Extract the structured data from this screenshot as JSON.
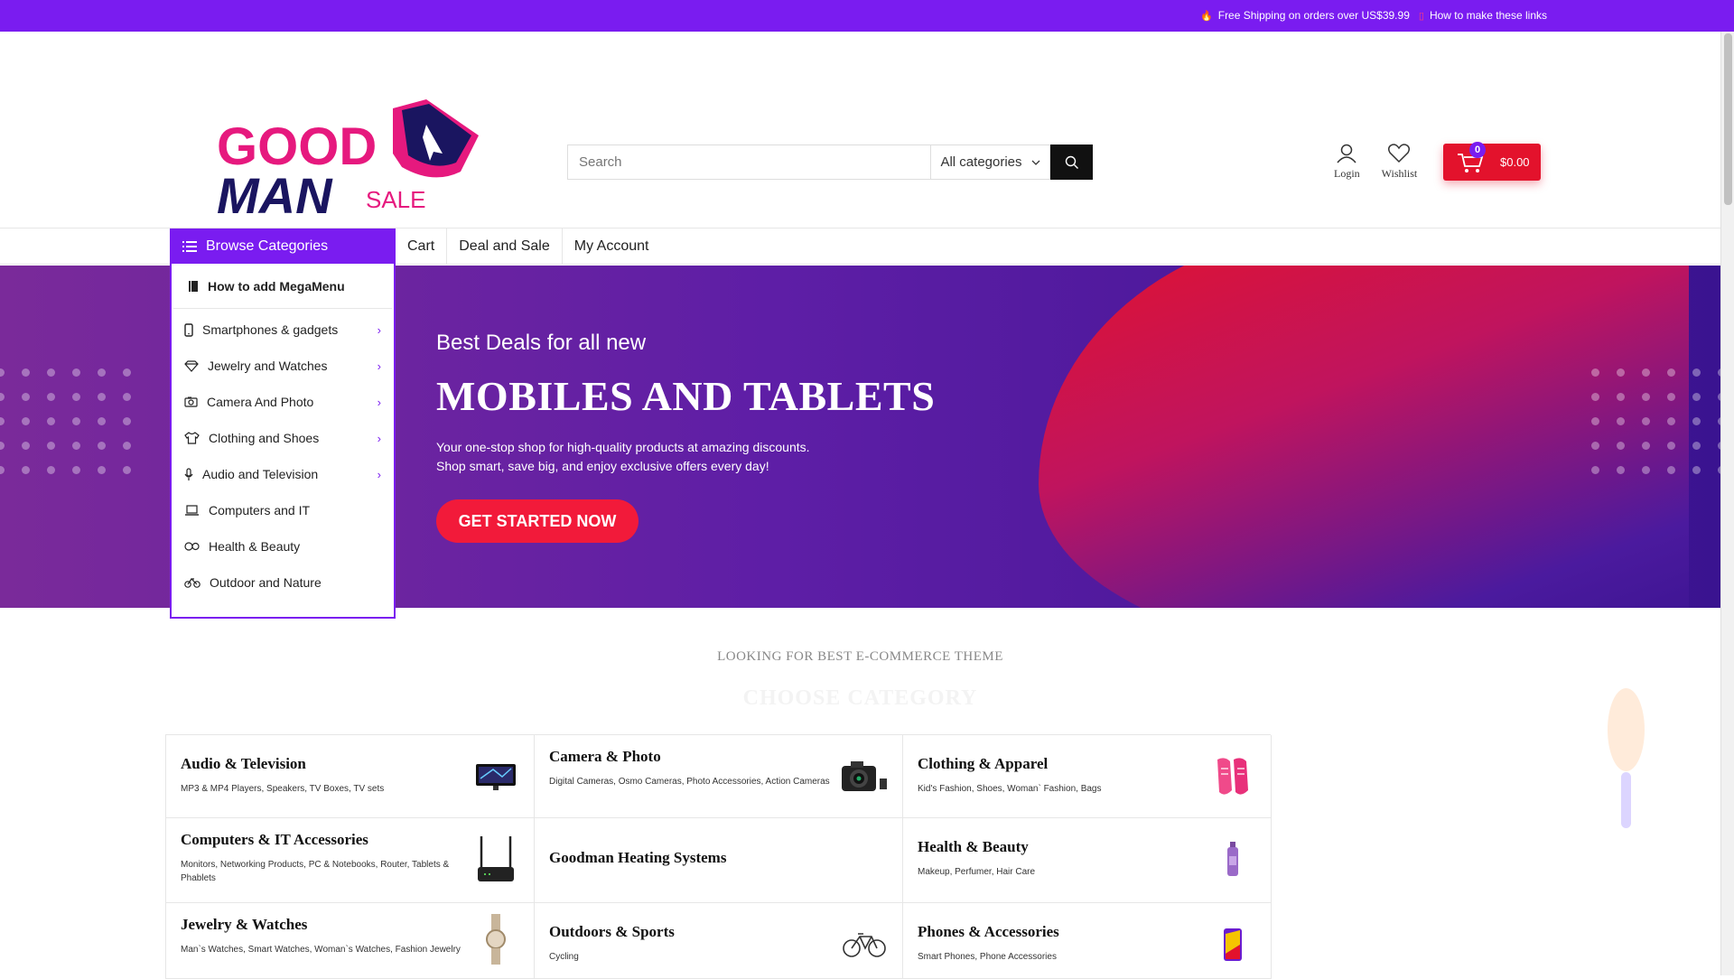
{
  "topbar": {
    "shipping_text": "Free Shipping on orders over US$39.99",
    "links_text": "How to make these links"
  },
  "logo": {
    "line1": "GOOD",
    "line2": "MAN",
    "tag": "SALE"
  },
  "search": {
    "placeholder": "Search",
    "category": "All categories"
  },
  "user_links": {
    "login": "Login",
    "wishlist": "Wishlist"
  },
  "cart": {
    "count": "0",
    "total": "$0.00"
  },
  "nav": {
    "browse_label": "Browse Categories",
    "links": [
      "Cart",
      "Deal and Sale",
      "My Account"
    ]
  },
  "megamenu": {
    "head": "How to add MegaMenu",
    "items": [
      {
        "label": "Smartphones & gadgets",
        "icon": "smartphone-icon"
      },
      {
        "label": "Jewelry and Watches",
        "icon": "diamond-icon"
      },
      {
        "label": "Camera And Photo",
        "icon": "camera-icon"
      },
      {
        "label": "Clothing and Shoes",
        "icon": "tshirt-icon"
      },
      {
        "label": "Audio and Television",
        "icon": "microphone-icon"
      },
      {
        "label": "Computers and IT",
        "icon": "laptop-icon"
      },
      {
        "label": "Health & Beauty",
        "icon": "pills-icon"
      },
      {
        "label": "Outdoor and Nature",
        "icon": "bicycle-icon"
      }
    ]
  },
  "hero": {
    "subtitle": "Best Deals for all new",
    "title": "MOBILES AND TABLETS",
    "line1": "Your one-stop shop for high-quality products at amazing discounts.",
    "line2": "Shop smart, save big, and enjoy exclusive offers every day!",
    "cta": "GET STARTED NOW"
  },
  "section": {
    "kicker": "LOOKING FOR BEST E-COMMERCE THEME",
    "title": "CHOOSE CATEGORY"
  },
  "categories": [
    {
      "title": "Audio & Television",
      "desc": "MP3 & MP4 Players, Speakers, TV Boxes, TV sets",
      "icon": "monitor-icon"
    },
    {
      "title": "Camera & Photo",
      "desc": "Digital Cameras, Osmo Cameras, Photo Accessories, Action Cameras",
      "icon": "camera-icon"
    },
    {
      "title": "Clothing & Apparel",
      "desc": "Kid's Fashion, Shoes, Woman` Fashion, Bags",
      "icon": "sneakers-icon"
    },
    {
      "title": "Computers & IT Accessories",
      "desc": "Monitors, Networking Products, PC & Notebooks, Router, Tablets & Phablets",
      "icon": "router-icon"
    },
    {
      "title": "Goodman Heating Systems",
      "desc": "",
      "icon": ""
    },
    {
      "title": "Health & Beauty",
      "desc": "Makeup, Perfumer, Hair Care",
      "icon": "perfume-icon"
    },
    {
      "title": "Jewelry & Watches",
      "desc": "Man`s Watches, Smart Watches, Woman`s Watches, Fashion Jewelry",
      "icon": "watch-icon"
    },
    {
      "title": "Outdoors & Sports",
      "desc": "Cycling",
      "icon": "bicycle-icon"
    },
    {
      "title": "Phones & Accessories",
      "desc": "Smart Phones, Phone Accessories",
      "icon": "phone-icon"
    }
  ],
  "colors": {
    "brand_purple": "#7a1cf0",
    "accent_red": "#e3122c",
    "logo_pink": "#e6197e",
    "logo_navy": "#1a1560"
  }
}
